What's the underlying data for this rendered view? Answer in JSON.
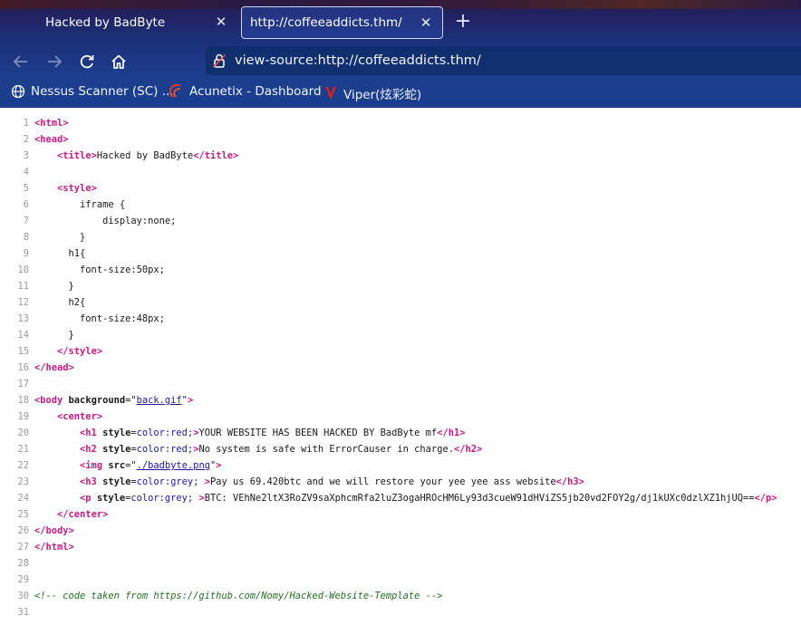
{
  "tabs": [
    {
      "title": "Hacked by BadByte",
      "active": false
    },
    {
      "title": "http://coffeeaddicts.thm/",
      "active": true
    }
  ],
  "url": "view-source:http://coffeeaddicts.thm/",
  "bookmarks": [
    {
      "label": "Nessus Scanner (SC) ...",
      "icon": "globe-icon"
    },
    {
      "label": "Acunetix - Dashboard",
      "icon": "acunetix-icon"
    },
    {
      "label": "Viper(炫彩蛇)",
      "icon": "viper-icon"
    }
  ],
  "colors": {
    "tag": "#c41a84",
    "attr_value": "#1a1aa6",
    "comment": "#236e25",
    "line_number": "#9a9a9a"
  },
  "source": {
    "line_numbers": [
      "1",
      "2",
      "3",
      "4",
      "5",
      "6",
      "7",
      "8",
      "9",
      "10",
      "11",
      "12",
      "13",
      "14",
      "15",
      "16",
      "17",
      "18",
      "19",
      "20",
      "21",
      "22",
      "23",
      "24",
      "25",
      "26",
      "27",
      "28",
      "29",
      "30",
      "31"
    ],
    "l3_text": "Hacked by BadByte",
    "l6": "iframe {",
    "l7": "display:none;",
    "l8": "}",
    "l9": "h1{",
    "l10": "font-size:50px;",
    "l11": "}",
    "l12": "h2{",
    "l13": "font-size:48px;",
    "l14": "}",
    "l18_href": "back.gif",
    "l20_style": "color:red;",
    "l20_text": "YOUR WEBSITE HAS BEEN HACKED BY BadByte mf",
    "l21_style": "color:red;",
    "l21_text": "No system is safe with ErrorCauser in charge.",
    "l22_src": "./badbyte.png",
    "l23_style": "color:grey;",
    "l23_text": "Pay us 69.420btc and we will restore your yee yee ass website",
    "l24_style": "color:grey;",
    "l24_text": "BTC: VEhNe2ltX3RoZV9saXphcmRfa2luZ3ogaHROcHM6Ly93d3cueW91dHViZS5jb20vd2FOY2g/dj1kUXc0dzlXZ1hjUQ==",
    "l30_comment": "<!-- code taken from https://github.com/Nomy/Hacked-Website-Template -->"
  }
}
